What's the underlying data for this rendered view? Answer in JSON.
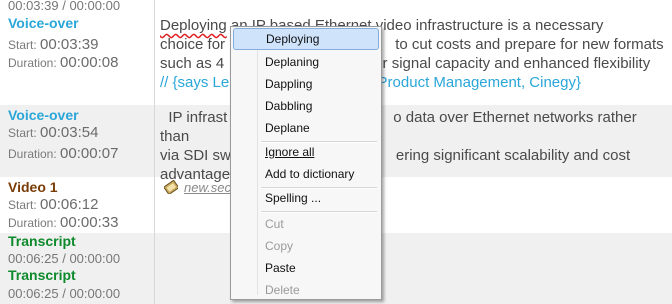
{
  "top_time": "00:03:39 / 00:00:00",
  "entries": [
    {
      "type": "Voice-over",
      "start_label": "Start:",
      "start": "00:03:39",
      "duration_label": "Duration:",
      "duration": "00:00:08"
    },
    {
      "type": "Voice-over",
      "start_label": "Start:",
      "start": "00:03:54",
      "duration_label": "Duration:",
      "duration": "00:00:07"
    },
    {
      "type": "Video 1",
      "start_label": "Start:",
      "start": "00:06:12",
      "duration_label": "Duration:",
      "duration": "00:00:33"
    },
    {
      "type": "Transcript",
      "time": "00:06:25 / 00:00:00"
    },
    {
      "type": "Transcript",
      "time": "00:06:25 / 00:00:00"
    }
  ],
  "paragraph1": {
    "l1_a": "Deploying",
    "l1_b": " an IP based Ethernet video infrastructure is a necessary",
    "l2_a": "choice for",
    "l2_b": " to cut costs and prepare for new formats",
    "l3_a": "such as 4",
    "l3_b": "er signal capacity and enhanced flexibility",
    "l4_a": "//  {says Le",
    "l4_b": "f Product Management, Cinegy}"
  },
  "paragraph2": {
    "l1_a": "  IP infrast",
    "l1_b": "o data over Ethernet networks rather than",
    "l2_a": "via SDI sw",
    "l2_b": "ering significant scalability and cost",
    "l3_a": "advantage"
  },
  "file_link": "new.sec",
  "context_menu": {
    "items": [
      {
        "label": "Deploying",
        "state": "selected"
      },
      {
        "label": "Deplaning",
        "state": "normal"
      },
      {
        "label": "Dappling",
        "state": "normal"
      },
      {
        "label": "Dabbling",
        "state": "normal"
      },
      {
        "label": "Deplane",
        "state": "normal"
      },
      {
        "label": "Ignore all",
        "state": "normal"
      },
      {
        "label": "Add to dictionary",
        "state": "normal"
      },
      {
        "label": "Spelling ...",
        "state": "normal"
      },
      {
        "label": "Cut",
        "state": "disabled"
      },
      {
        "label": "Copy",
        "state": "disabled"
      },
      {
        "label": "Paste",
        "state": "normal"
      },
      {
        "label": "Delete",
        "state": "disabled"
      }
    ]
  }
}
